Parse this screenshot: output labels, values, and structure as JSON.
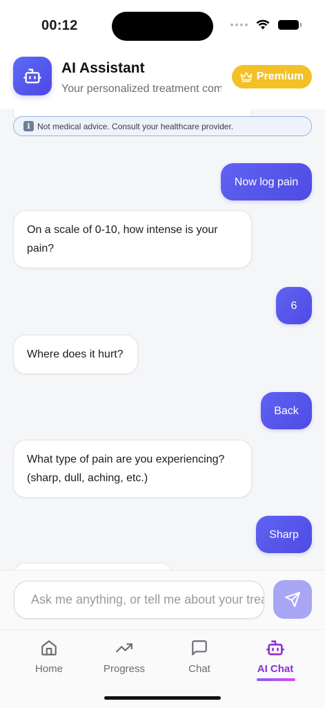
{
  "status_bar": {
    "time": "00:12"
  },
  "header": {
    "title": "AI Assistant",
    "subtitle": "Your personalized treatment com...",
    "premium_label": "Premium",
    "logo_icon": "robot-icon",
    "accent": "#4f46e5",
    "premium_color": "#f3c026"
  },
  "disclaimer": {
    "icon": "info-icon",
    "text": "Not medical advice. Consult your healthcare provider."
  },
  "messages": [
    {
      "role": "user",
      "text": "Now log pain"
    },
    {
      "role": "assistant",
      "text": "On a scale of 0-10, how intense is your pain?"
    },
    {
      "role": "user",
      "text": "6"
    },
    {
      "role": "assistant",
      "text": "Where does it hurt?"
    },
    {
      "role": "user",
      "text": "Back"
    },
    {
      "role": "assistant",
      "text": "What type of pain are you experiencing? (sharp, dull, aching, etc.)"
    },
    {
      "role": "user",
      "text": "Sharp"
    }
  ],
  "input": {
    "placeholder": "Ask me anything, or tell me about your treatment..."
  },
  "tabs": [
    {
      "label": "Home",
      "icon": "home-icon"
    },
    {
      "label": "Progress",
      "icon": "trending-up-icon"
    },
    {
      "label": "Chat",
      "icon": "chat-bubble-icon"
    },
    {
      "label": "AI Chat",
      "icon": "robot-icon",
      "active": true
    }
  ]
}
